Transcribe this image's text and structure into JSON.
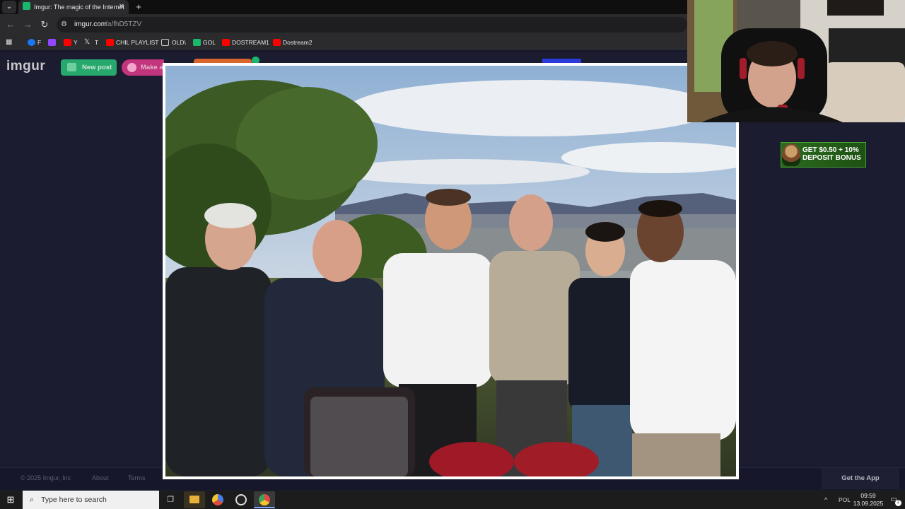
{
  "browser": {
    "tab_title": "Imgur: The magic of the Internet",
    "url_host": "imgur.com",
    "url_path": "/a/fhD5TZV",
    "bookmarks": [
      {
        "label": "F",
        "color": "#1877f2",
        "icon": "facebook-icon"
      },
      {
        "label": "",
        "color": "#9146ff",
        "icon": "twitch-icon"
      },
      {
        "label": "Y",
        "color": "#ff0000",
        "icon": "youtube-icon"
      },
      {
        "label": "T",
        "color": "#ffffff",
        "icon": "x-icon"
      },
      {
        "label": "CHIL PLAYLIST",
        "color": "#ff0000",
        "icon": "youtube-icon"
      },
      {
        "label": "OLD\\",
        "color": "#cccccc",
        "icon": "folder-icon"
      },
      {
        "label": "GOL",
        "color": "#1bb76e",
        "icon": "site-icon"
      },
      {
        "label": "DOSTREAM1",
        "color": "#ff0000",
        "icon": "youtube-icon"
      },
      {
        "label": "Dostream2",
        "color": "#ff0000",
        "icon": "youtube-icon"
      }
    ]
  },
  "imgur": {
    "logo": "imgur",
    "new_post": "New post",
    "make_meme": "Make a Meme",
    "footer": {
      "copyright": "© 2025 Imgur, Inc",
      "about": "About",
      "terms": "Terms",
      "get_app": "Get the App"
    },
    "ad": {
      "line1": "GET $0.50 + 10%",
      "line2": "DEPOSIT BONUS"
    }
  },
  "taskbar": {
    "search_placeholder": "Type here to search",
    "tray_language": "POL",
    "time": "09:59",
    "date": "13.09.2025",
    "notification_count": "2"
  },
  "colors": {
    "imgur_bg": "#1b1c2f",
    "new_post": "#27a86c",
    "make_meme": "#c2357d"
  }
}
